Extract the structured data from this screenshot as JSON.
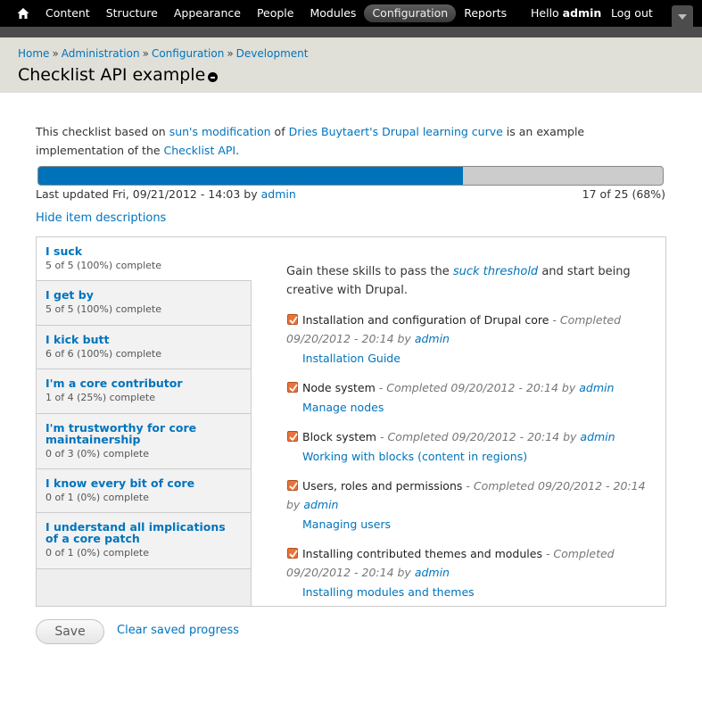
{
  "toolbar": {
    "nav": [
      "Content",
      "Structure",
      "Appearance",
      "People",
      "Modules",
      "Configuration",
      "Reports"
    ],
    "active": "Configuration",
    "hello": "Hello",
    "username": "admin",
    "logout": "Log out"
  },
  "breadcrumb": [
    "Home",
    "Administration",
    "Configuration",
    "Development"
  ],
  "breadcrumb_sep": "»",
  "page_title": "Checklist API example",
  "intro": {
    "t1": "This checklist based on ",
    "l1": "sun's modification",
    "t2": " of ",
    "l2": "Dries Buytaert's Drupal learning curve",
    "t3": " is an example implementation of the ",
    "l3": "Checklist API",
    "t4": "."
  },
  "progress": {
    "fraction": 0.68,
    "last_updated_prefix": "Last updated Fri, 09/21/2012 - 14:03 by ",
    "last_updated_user": "admin",
    "count": "17 of 25 (68%)"
  },
  "hide_descriptions": "Hide item descriptions",
  "tabs": [
    {
      "title": "I suck",
      "summary": "5 of 5 (100%) complete"
    },
    {
      "title": "I get by",
      "summary": "5 of 5 (100%) complete"
    },
    {
      "title": "I kick butt",
      "summary": "6 of 6 (100%) complete"
    },
    {
      "title": "I'm a core contributor",
      "summary": "1 of 4 (25%) complete"
    },
    {
      "title": "I'm trustworthy for core maintainership",
      "summary": "0 of 3 (0%) complete"
    },
    {
      "title": "I know every bit of core",
      "summary": "0 of 1 (0%) complete"
    },
    {
      "title": "I understand all implications of a core patch",
      "summary": "0 of 1 (0%) complete"
    }
  ],
  "pane": {
    "desc_before": "Gain these skills to pass the ",
    "desc_link": "suck threshold",
    "desc_after": " and start being creative with Drupal.",
    "items": [
      {
        "label": "Installation and configuration of Drupal core",
        "meta": " - Completed 09/20/2012 - 20:14 by ",
        "user": "admin",
        "link": "Installation Guide"
      },
      {
        "label": "Node system",
        "meta": " - Completed 09/20/2012 - 20:14 by ",
        "user": "admin",
        "link": "Manage nodes"
      },
      {
        "label": "Block system",
        "meta": " - Completed 09/20/2012 - 20:14 by ",
        "user": "admin",
        "link": "Working with blocks (content in regions)"
      },
      {
        "label": "Users, roles and permissions",
        "meta": " - Completed 09/20/2012 - 20:14 by ",
        "user": "admin",
        "link": "Managing users"
      },
      {
        "label": "Installing contributed themes and modules",
        "meta": " - Completed 09/20/2012 - 20:14 by ",
        "user": "admin",
        "link": "Installing modules and themes"
      }
    ]
  },
  "buttons": {
    "save": "Save",
    "clear": "Clear saved progress"
  },
  "colors": {
    "toolbar_bg": "#000000",
    "link": "#0074bd",
    "progress_fill": "#0072b9",
    "checkbox": "#e8743b",
    "header_bg": "#e0e0d8"
  }
}
